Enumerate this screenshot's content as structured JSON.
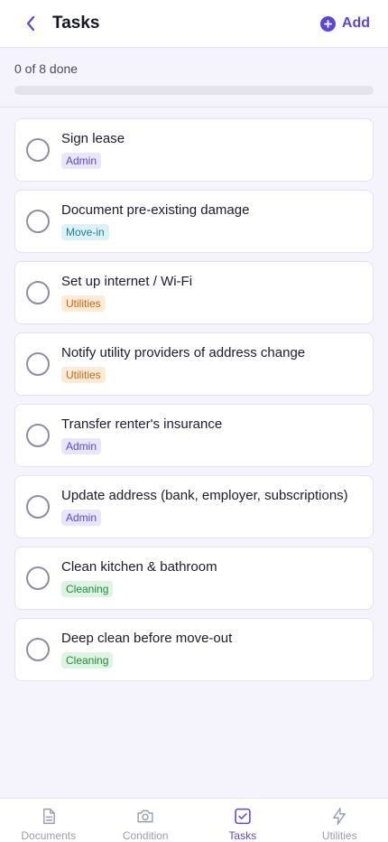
{
  "header": {
    "title": "Tasks",
    "add_label": "Add"
  },
  "progress": {
    "text": "0 of 8 done",
    "fraction": 0
  },
  "tasks": [
    {
      "title": "Sign lease",
      "tag": "Admin",
      "tag_kind": "admin"
    },
    {
      "title": "Document pre-existing damage",
      "tag": "Move-in",
      "tag_kind": "movein"
    },
    {
      "title": "Set up internet / Wi-Fi",
      "tag": "Utilities",
      "tag_kind": "utilities"
    },
    {
      "title": "Notify utility providers of address change",
      "tag": "Utilities",
      "tag_kind": "utilities"
    },
    {
      "title": "Transfer renter's insurance",
      "tag": "Admin",
      "tag_kind": "admin"
    },
    {
      "title": "Update address (bank, employer, subscriptions)",
      "tag": "Admin",
      "tag_kind": "admin"
    },
    {
      "title": "Clean kitchen & bathroom",
      "tag": "Cleaning",
      "tag_kind": "cleaning"
    },
    {
      "title": "Deep clean before move-out",
      "tag": "Cleaning",
      "tag_kind": "cleaning"
    }
  ],
  "bottom_nav": [
    {
      "label": "Documents",
      "icon": "document-icon",
      "active": false
    },
    {
      "label": "Condition",
      "icon": "camera-icon",
      "active": false
    },
    {
      "label": "Tasks",
      "icon": "checkbox-icon",
      "active": true
    },
    {
      "label": "Utilities",
      "icon": "lightning-icon",
      "active": false
    }
  ],
  "colors": {
    "accent": "#5b47d6",
    "background": "#f5f4fc"
  }
}
